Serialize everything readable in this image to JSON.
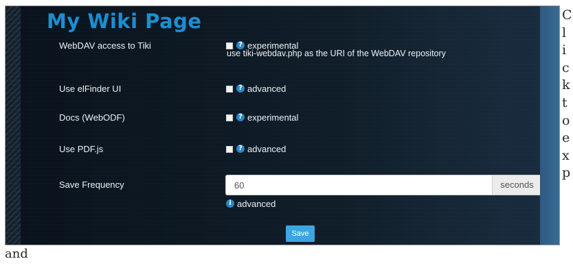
{
  "page_title": "My Wiki Page",
  "settings": [
    {
      "label": "WebDAV access to Tiki",
      "tag": "experimental"
    },
    {
      "label": "Use elFinder UI",
      "tag": "advanced"
    },
    {
      "label": "Docs (WebODF)",
      "tag": "experimental"
    },
    {
      "label": "Use PDF.js",
      "tag": "advanced"
    }
  ],
  "webdav_note": "use tiki-webdav.php as the URI of the WebDAV repository",
  "save_frequency": {
    "label": "Save Frequency",
    "value": "60",
    "unit": "seconds",
    "tag": "advanced"
  },
  "save_label": "Save",
  "icons": {
    "help": "?",
    "info": "i"
  },
  "side_letters": [
    "C",
    "l",
    "i",
    "c",
    "k",
    "t",
    "o",
    "e",
    "x",
    "p"
  ],
  "expand_tail": "and",
  "colors": {
    "accent": "#1a8fd2",
    "button": "#3aa6e4",
    "help_icon": "#2b86c4"
  }
}
